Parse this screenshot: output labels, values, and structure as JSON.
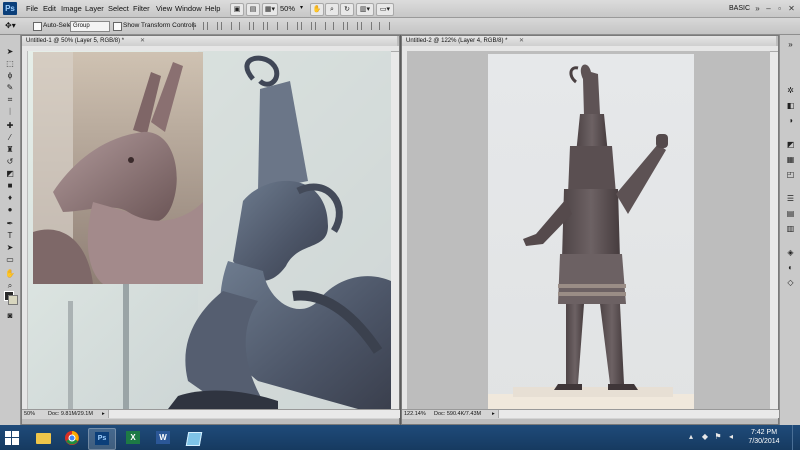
{
  "menubar": {
    "logo": "Ps",
    "items": [
      "File",
      "Edit",
      "Image",
      "Layer",
      "Select",
      "Filter",
      "View",
      "Window",
      "Help"
    ],
    "zoom": "50%",
    "workspace": "BASIC"
  },
  "options": {
    "auto_select_label": "Auto-Select:",
    "auto_select_value": "Group",
    "show_transform_label": "Show Transform Controls"
  },
  "doc1": {
    "tab_title": "Untitled-1 @ 50% (Layer 5, RGB/8) *",
    "zoom": "50%",
    "doc_info": "Doc: 9.81M/29.1M"
  },
  "doc2": {
    "tab_title": "Untitled-2 @ 122% (Layer 4, RGB/8) *",
    "zoom": "122.14%",
    "doc_info": "Doc: 590.4K/7.43M"
  },
  "taskbar": {
    "apps": [
      "file-explorer",
      "chrome",
      "photoshop",
      "excel",
      "word",
      "app"
    ],
    "time": "7:42 PM",
    "date": "7/30/2014"
  },
  "colors": {
    "accent": "#1f4b7a",
    "ps_blue": "#0b3f7a"
  }
}
